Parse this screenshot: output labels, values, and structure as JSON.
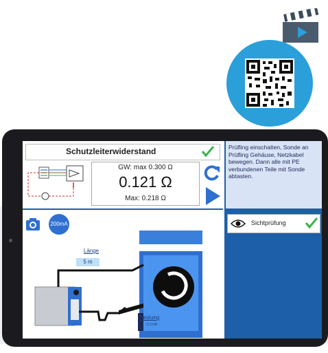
{
  "measurement": {
    "title": "Schutzleiterwiderstand",
    "limit_text": "GW: max 0.300 Ω",
    "value_text": "0.121 Ω",
    "max_text": "Max: 0.218 Ω"
  },
  "instructions": {
    "text": "Prüfling einschalten, Sonde an Prüfling Gehäuse, Netzkabel bewegen. Dann alle mit PE verbundenen Teile mit Sonde abtasten."
  },
  "scene": {
    "current_button_label": "200mA",
    "cable_length_label": "Länge",
    "cable_length_value": "5 m",
    "device_label": "Heizung",
    "device_small_value": "~2,3 kW"
  },
  "visual_check": {
    "label": "Sichtprüfung"
  },
  "colors": {
    "accent_blue": "#1d5fa8",
    "bright_blue": "#2f6fd0",
    "qr_blue": "#2b9fd9",
    "check_green": "#3ab54a",
    "instruction_bg": "#d9e3f6"
  },
  "icons": [
    "video-clapboard-icon",
    "qr-code-icon",
    "check-icon",
    "refresh-icon",
    "play-icon",
    "camera-icon",
    "eye-icon"
  ]
}
